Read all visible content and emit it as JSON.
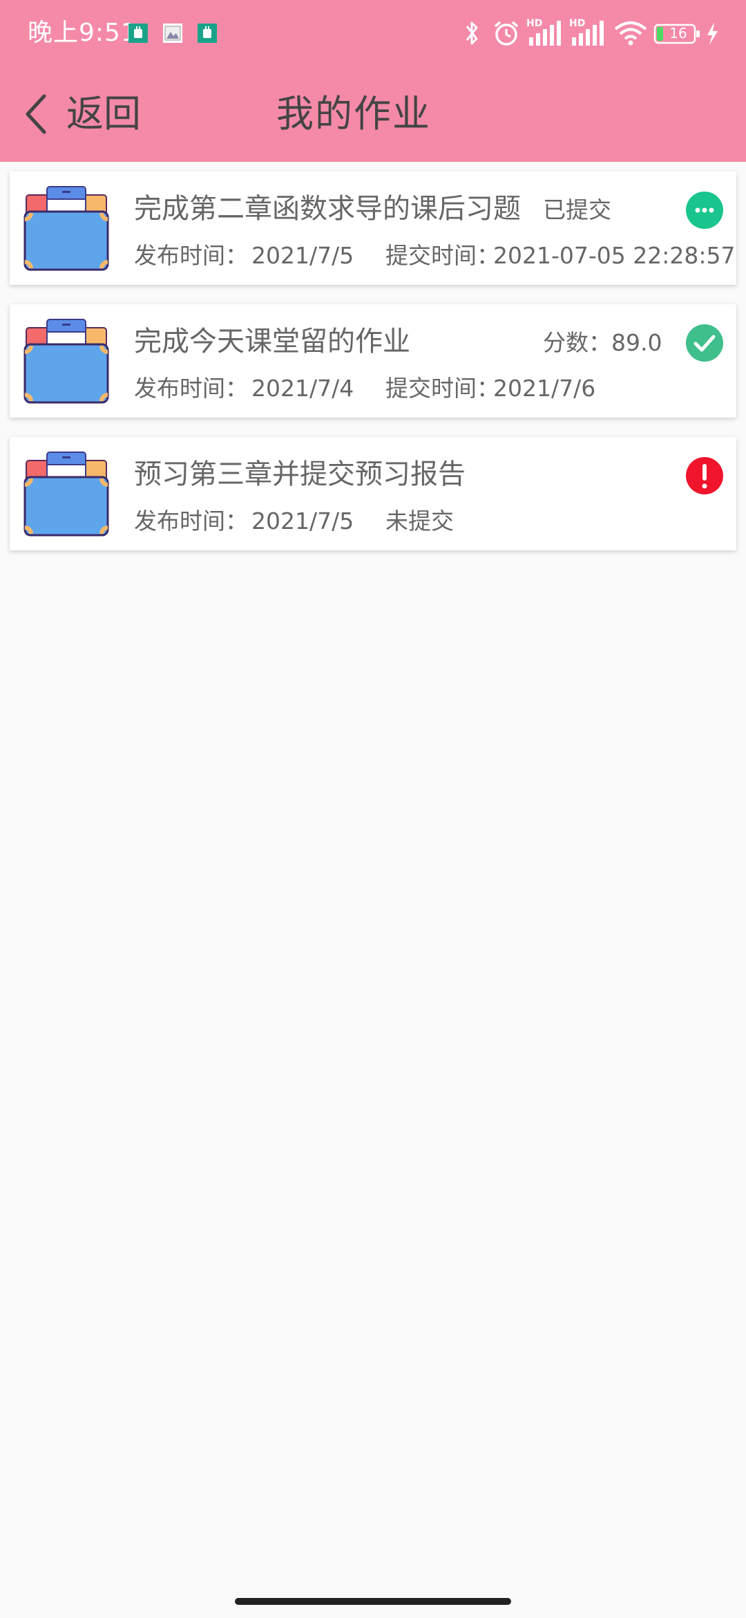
{
  "status_bar": {
    "time": "晚上9:51",
    "battery": "16",
    "signal_label_1": "HD",
    "signal_label_2": "HD"
  },
  "nav": {
    "back_label": "返回",
    "title": "我的作业"
  },
  "homework": [
    {
      "title": "完成第二章函数求导的课后习题",
      "status_text": "已提交",
      "publish_label": "发布时间：",
      "publish_date": "2021/7/5",
      "submit_label": "提交时间：",
      "submit_time": "2021-07-05 22:28:57",
      "badge": "more-icon",
      "badge_color": "#19c58c"
    },
    {
      "title": "完成今天课堂留的作业",
      "status_text": "分数：89.0",
      "publish_label": "发布时间：",
      "publish_date": "2021/7/4",
      "submit_label": "提交时间：",
      "submit_time": "2021/7/6",
      "badge": "check-icon",
      "badge_color": "#3fbf8c"
    },
    {
      "title": "预习第三章并提交预习报告",
      "publish_label": "发布时间：",
      "publish_date": "2021/7/5",
      "submit_status": "未提交",
      "badge": "alert-icon",
      "badge_color": "#f0142c"
    }
  ],
  "colors": {
    "header": "#f58aa8",
    "background": "#fafafa"
  }
}
